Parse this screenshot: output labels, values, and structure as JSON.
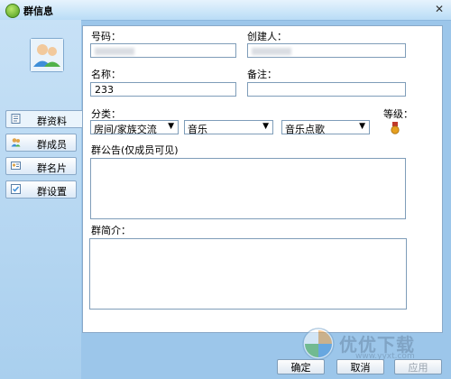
{
  "window": {
    "title": "群信息",
    "close_symbol": "✕"
  },
  "sidebar": {
    "items": [
      {
        "label": "群资料",
        "icon": "doc-icon",
        "active": true
      },
      {
        "label": "群成员",
        "icon": "members-icon",
        "active": false
      },
      {
        "label": "群名片",
        "icon": "card-icon",
        "active": false
      },
      {
        "label": "群设置",
        "icon": "settings-icon",
        "active": false
      }
    ]
  },
  "form": {
    "number_label": "号码：",
    "number_value": "",
    "creator_label": "创建人：",
    "creator_value": "",
    "name_label": "名称：",
    "name_value": "233",
    "remark_label": "备注：",
    "remark_value": "",
    "category_label": "分类：",
    "category_1": "房间/家族交流",
    "category_2": "音乐",
    "category_3": "音乐点歌",
    "level_label": "等级：",
    "notice_label": "群公告(仅成员可见)",
    "intro_label": "群简介："
  },
  "footer": {
    "ok_label": "确定",
    "cancel_label": "取消",
    "apply_label": "应用"
  },
  "watermark": {
    "text": "优优下载",
    "url": "www.yyxt.com"
  },
  "colors": {
    "titlebar": "#b9dcf6",
    "background": "#9cc6ea",
    "panel": "#ffffff"
  }
}
